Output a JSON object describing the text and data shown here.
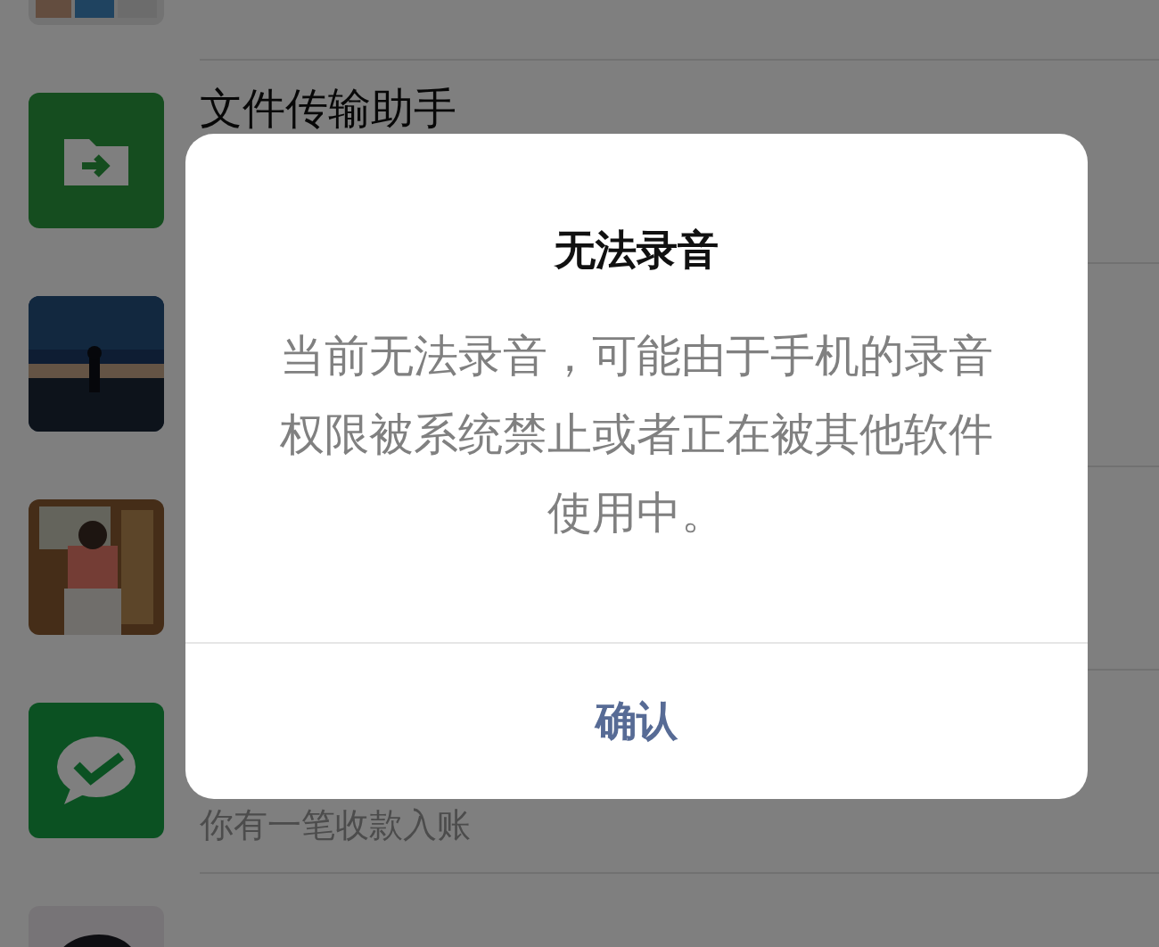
{
  "chats": [
    {
      "kind": "group"
    },
    {
      "kind": "file",
      "name": "文件传输助手"
    },
    {
      "kind": "night"
    },
    {
      "kind": "door"
    },
    {
      "kind": "pay",
      "preview": "你有一笔收款入账"
    },
    {
      "kind": "figure"
    }
  ],
  "dialog": {
    "title": "无法录音",
    "message": "当前无法录音，可能由于手机的录音权限被系统禁止或者正在被其他软件使用中。",
    "button": "确认"
  }
}
